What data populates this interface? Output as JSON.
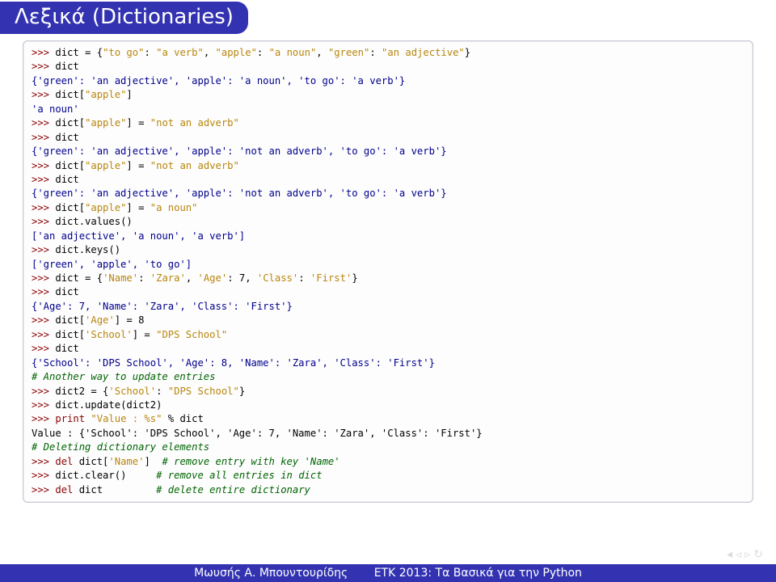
{
  "title": "Λεξικά (Dictionaries)",
  "code": {
    "l1a": ">>> ",
    "l1b": "dict = {",
    "l1c": "\"to go\"",
    "l1d": ": ",
    "l1e": "\"a verb\"",
    "l1f": ", ",
    "l1g": "\"apple\"",
    "l1h": ": ",
    "l1i": "\"a noun\"",
    "l1j": ", ",
    "l1k": "\"green\"",
    "l1l": ": ",
    "l1m": "\"an adjective\"",
    "l1n": "}",
    "l2a": ">>> ",
    "l2b": "dict",
    "l3": "{'green': 'an adjective', 'apple': 'a noun', 'to go': 'a verb'}",
    "l4a": ">>> ",
    "l4b": "dict[",
    "l4c": "\"apple\"",
    "l4d": "]",
    "l5": "'a noun'",
    "l6a": ">>> ",
    "l6b": "dict[",
    "l6c": "\"apple\"",
    "l6d": "] = ",
    "l6e": "\"not an adverb\"",
    "l7a": ">>> ",
    "l7b": "dict",
    "l8": "{'green': 'an adjective', 'apple': 'not an adverb', 'to go': 'a verb'}",
    "l9a": ">>> ",
    "l9b": "dict[",
    "l9c": "\"apple\"",
    "l9d": "] = ",
    "l9e": "\"not an adverb\"",
    "l10a": ">>> ",
    "l10b": "dict",
    "l11": "{'green': 'an adjective', 'apple': 'not an adverb', 'to go': 'a verb'}",
    "l12a": ">>> ",
    "l12b": "dict[",
    "l12c": "\"apple\"",
    "l12d": "] = ",
    "l12e": "\"a noun\"",
    "l13a": ">>> ",
    "l13b": "dict.values()",
    "l14": "['an adjective', 'a noun', 'a verb']",
    "l15a": ">>> ",
    "l15b": "dict.keys()",
    "l16": "['green', 'apple', 'to go']",
    "l17a": ">>> ",
    "l17b": "dict = {",
    "l17c": "'Name'",
    "l17d": ": ",
    "l17e": "'Zara'",
    "l17f": ", ",
    "l17g": "'Age'",
    "l17h": ": 7, ",
    "l17i": "'Class'",
    "l17j": ": ",
    "l17k": "'First'",
    "l17l": "}",
    "l18a": ">>> ",
    "l18b": "dict",
    "l19": "{'Age': 7, 'Name': 'Zara', 'Class': 'First'}",
    "l20a": ">>> ",
    "l20b": "dict[",
    "l20c": "'Age'",
    "l20d": "] = 8",
    "l21a": ">>> ",
    "l21b": "dict[",
    "l21c": "'School'",
    "l21d": "] = ",
    "l21e": "\"DPS School\"",
    "l22a": ">>> ",
    "l22b": "dict",
    "l23": "{'School': 'DPS School', 'Age': 8, 'Name': 'Zara', 'Class': 'First'}",
    "l24": "# Another way to update entries",
    "l25a": ">>> ",
    "l25b": "dict2 = {",
    "l25c": "'School'",
    "l25d": ": ",
    "l25e": "\"DPS School\"",
    "l25f": "}",
    "l26a": ">>> ",
    "l26b": "dict.update(dict2)",
    "l27a": ">>> ",
    "l27b": "print",
    "l27c": " ",
    "l27d": "\"Value : %s\"",
    "l27e": " % dict",
    "l28": "Value : {'School': 'DPS School', 'Age': 7, 'Name': 'Zara', 'Class': 'First'}",
    "l29": "# Deleting dictionary elements",
    "l30a": ">>> ",
    "l30b": "del",
    "l30c": " dict[",
    "l30d": "'Name'",
    "l30e": "]  ",
    "l30f": "# remove entry with key 'Name'",
    "l31a": ">>> ",
    "l31b": "dict.clear()     ",
    "l31c": "# remove all entries in dict",
    "l32a": ">>> ",
    "l32b": "del",
    "l32c": " dict         ",
    "l32d": "# delete entire dictionary"
  },
  "footer": {
    "left": "Μωυσής Α. Μπουντουρίδης",
    "right": "ΕΤΚ 2013: Τα Βασικά για την Python"
  }
}
